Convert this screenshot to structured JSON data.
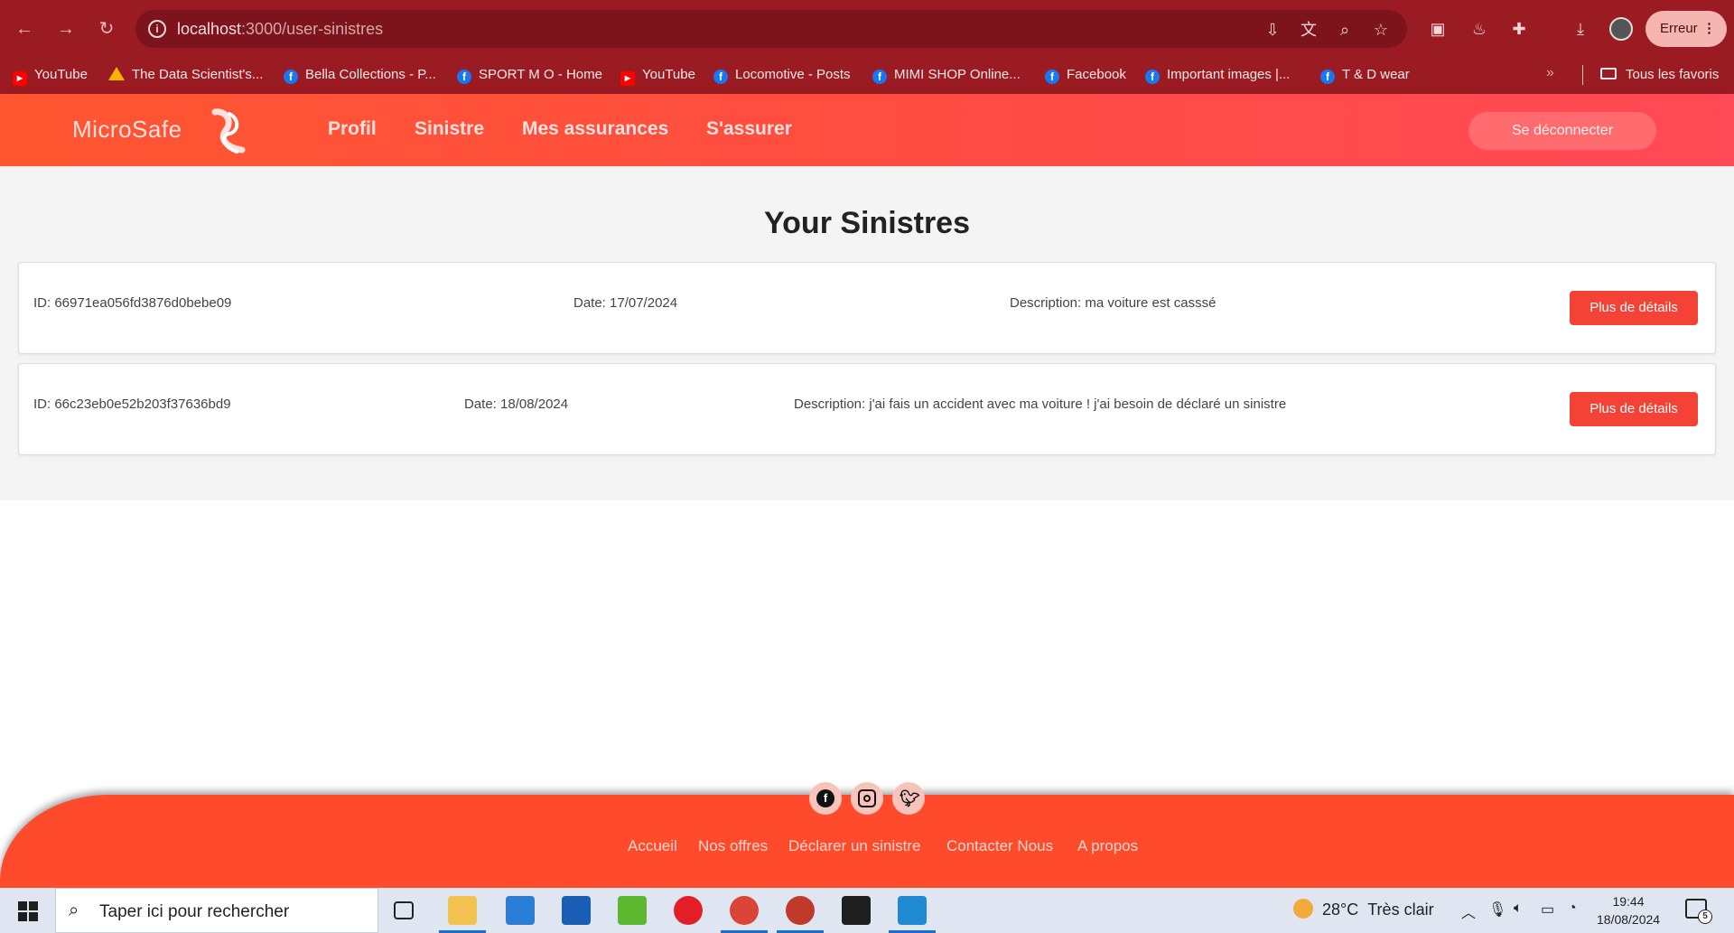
{
  "browser": {
    "url_host": "localhost",
    "url_path": ":3000/user-sinistres",
    "profile_label": "Erreur",
    "bookmarks": [
      {
        "label": "YouTube",
        "icon": "youtube-icon"
      },
      {
        "label": "The Data Scientist's...",
        "icon": "drive-icon"
      },
      {
        "label": "Bella Collections - P...",
        "icon": "facebook-icon"
      },
      {
        "label": "SPORT M O - Home",
        "icon": "facebook-icon"
      },
      {
        "label": "YouTube",
        "icon": "youtube-icon"
      },
      {
        "label": "Locomotive - Posts",
        "icon": "facebook-icon"
      },
      {
        "label": "MIMI SHOP Online...",
        "icon": "facebook-icon"
      },
      {
        "label": "Facebook",
        "icon": "facebook-icon"
      },
      {
        "label": "Important images |...",
        "icon": "facebook-icon"
      },
      {
        "label": "T & D wear",
        "icon": "facebook-icon"
      }
    ],
    "all_bookmarks_label": "Tous les favoris"
  },
  "header": {
    "brand": "MicroSafe",
    "nav": [
      "Profil",
      "Sinistre",
      "Mes assurances",
      "S'assurer"
    ],
    "logout_label": "Se déconnecter"
  },
  "main": {
    "title": "Your Sinistres",
    "sinistres": [
      {
        "id_text": "ID: 66971ea056fd3876d0bebe09",
        "date_text": "Date: 17/07/2024",
        "description_text": "Description: ma voiture est casssé",
        "button_label": "Plus de détails"
      },
      {
        "id_text": "ID: 66c23eb0e52b203f37636bd9",
        "date_text": "Date: 18/08/2024",
        "description_text": "Description: j'ai fais un accident avec ma voiture ! j'ai besoin de déclaré un sinistre",
        "button_label": "Plus de détails"
      }
    ]
  },
  "footer": {
    "social": [
      "facebook-icon",
      "instagram-icon",
      "twitter-icon"
    ],
    "links": [
      "Accueil",
      "Nos offres",
      "Déclarer un sinistre",
      "Contacter Nous",
      "A propos"
    ]
  },
  "taskbar": {
    "search_placeholder": "Taper ici pour rechercher",
    "weather_temp": "28°C",
    "weather_text": "Très clair",
    "time": "19:44",
    "date": "18/08/2024",
    "notification_count": "5"
  },
  "colors": {
    "browser_chrome": "#9b1b23",
    "header_gradient_start": "#ff5630",
    "header_gradient_end": "#ff4a57",
    "details_button": "#f44336",
    "footer": "#ff4b2b"
  }
}
